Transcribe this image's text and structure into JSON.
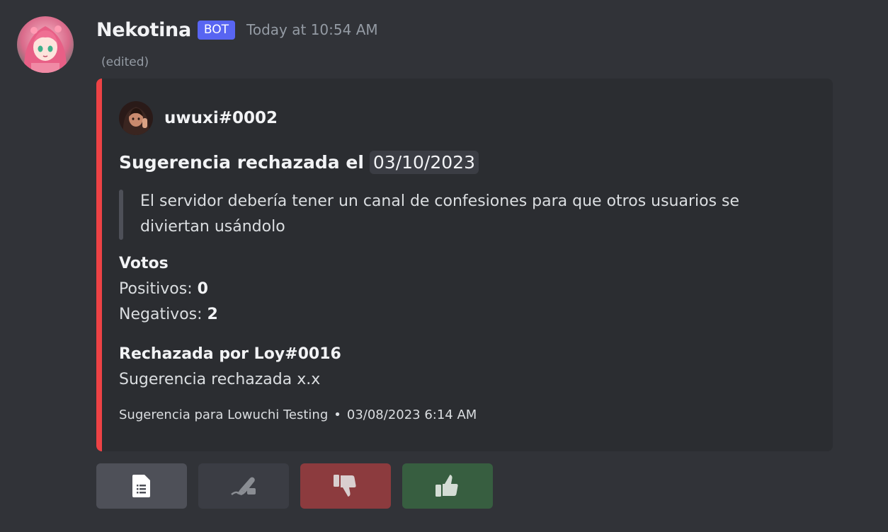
{
  "message": {
    "author": "Nekotina",
    "badge": "BOT",
    "timestamp": "Today at 10:54 AM",
    "edited": "(edited)"
  },
  "embed": {
    "color": "#ed4245",
    "author": "uwuxi#0002",
    "title_prefix": "Sugerencia rechazada el",
    "title_date": "03/10/2023",
    "quote": "El servidor debería tener un canal de confesiones para que otros usuarios se diviertan usándolo",
    "votes": {
      "name": "Votos",
      "positive_label": "Positivos:",
      "positive_value": "0",
      "negative_label": "Negativos:",
      "negative_value": "2"
    },
    "rejected": {
      "name": "Rechazada por Loy#0016",
      "value": "Sugerencia rechazada x.x"
    },
    "footer": {
      "text": "Sugerencia para Lowuchi Testing",
      "separator": "•",
      "date": "03/08/2023 6:14 AM"
    }
  },
  "buttons": [
    {
      "icon": "document-list-icon",
      "color": "#4e5058"
    },
    {
      "icon": "signature-hand-icon",
      "color": "#3b3d44"
    },
    {
      "icon": "thumbs-down-icon",
      "color": "#8c3b3e"
    },
    {
      "icon": "thumbs-up-icon",
      "color": "#375e40"
    }
  ]
}
